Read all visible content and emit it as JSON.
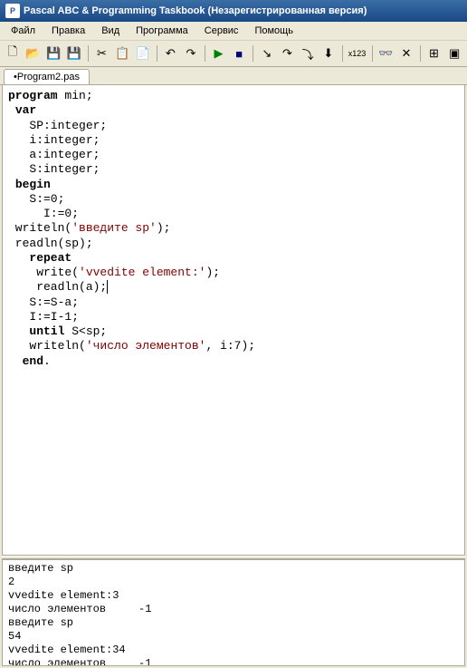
{
  "window": {
    "title": "Pascal ABC & Programming Taskbook (Незарегистрированная версия)"
  },
  "menu": {
    "file": "Файл",
    "edit": "Правка",
    "view": "Вид",
    "program": "Программа",
    "service": "Сервис",
    "help": "Помощь"
  },
  "toolbar": {
    "x123_label": "x123"
  },
  "tabs": {
    "active": "•Program2.pas"
  },
  "code": {
    "kw_program": "program",
    "prog_name": " min;",
    "kw_var": "var",
    "v1": "   SP:integer;",
    "v2": "   i:integer;",
    "v3": "   a:integer;",
    "v4": "   S:integer;",
    "kw_begin": "begin",
    "l1": "   S:=0;",
    "l2": "     I:=0;",
    "l3a": " writeln(",
    "l3s": "'введите sp'",
    "l3b": ");",
    "l4": " readln(sp);",
    "kw_repeat": "   repeat",
    "l5a": "    write(",
    "l5s": "'vvedite element:'",
    "l5b": ");",
    "l6": "    readln(a);",
    "l7": "   S:=S-a;",
    "l8": "   I:=I-1;",
    "kw_until": "   until",
    "l9": " S<sp;",
    "l10a": "   writeln(",
    "l10s": "'число элементов'",
    "l10b": ", i:7);",
    "kw_end": "  end",
    "dot": "."
  },
  "output": {
    "lines": "введите sp\n2\nvvedite element:3\nчисло элементов     -1\nвведите sp\n54\nvvedite element:34\nчисло элементов     -1"
  }
}
